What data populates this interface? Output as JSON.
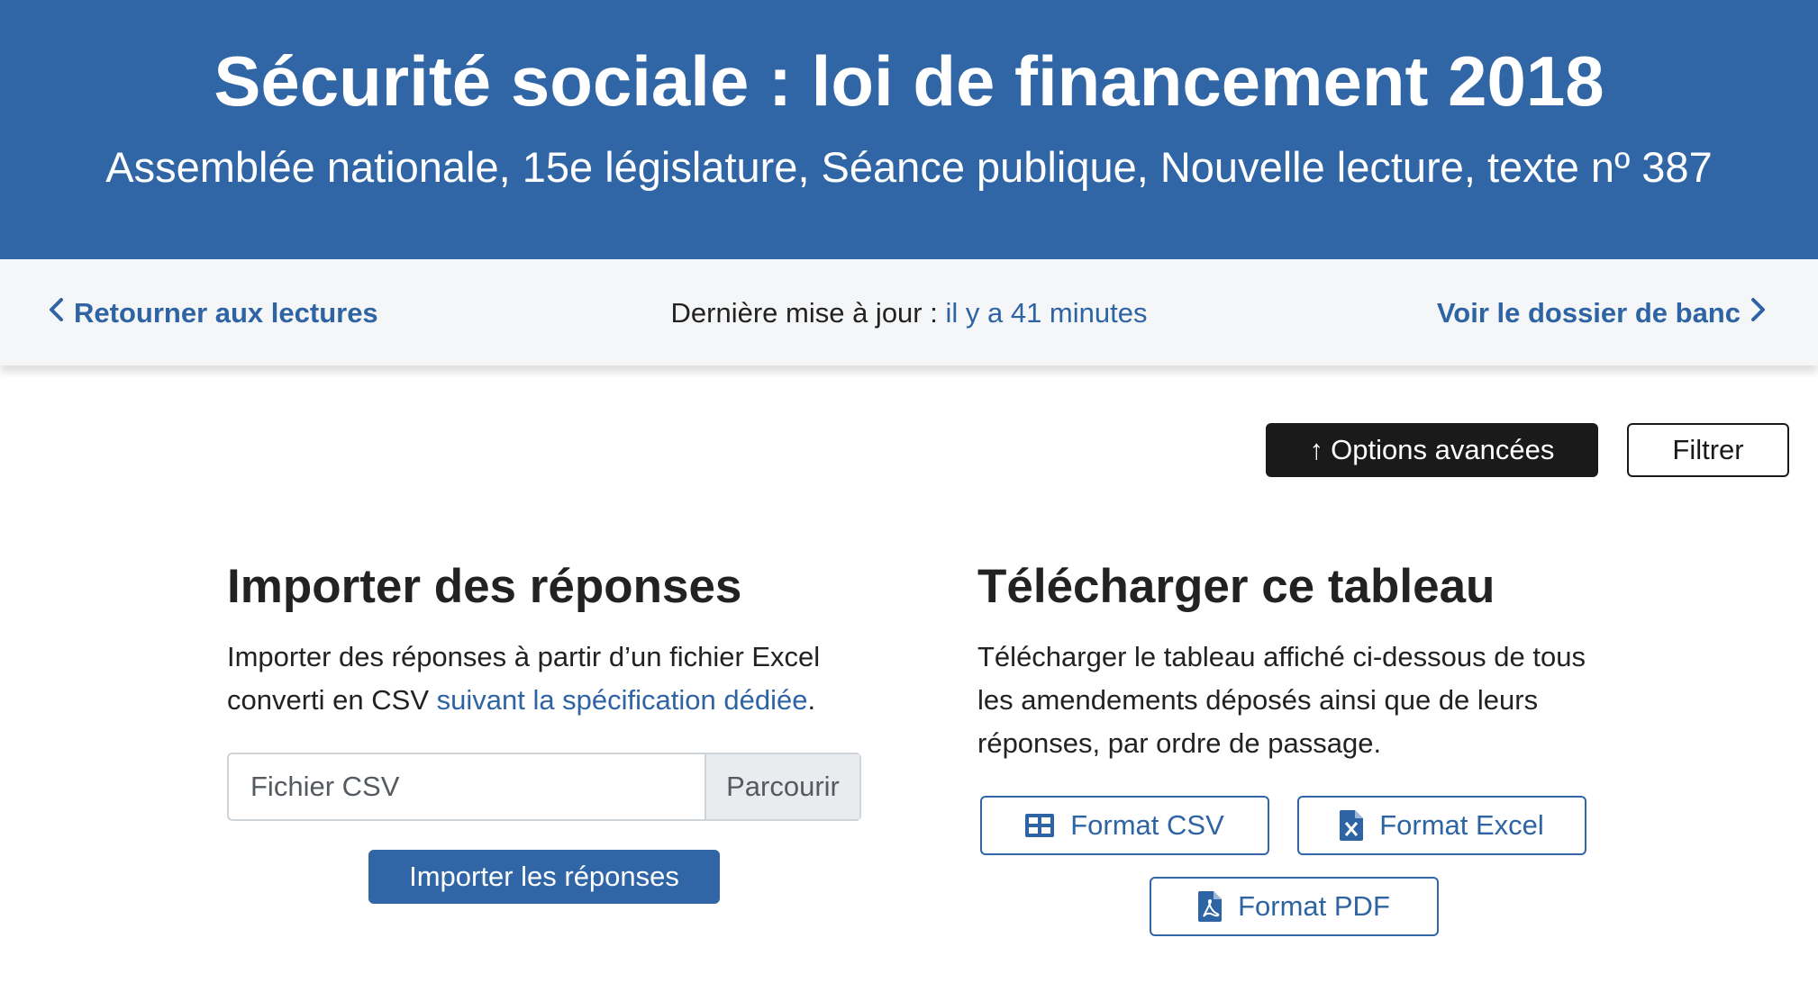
{
  "header": {
    "title": "Sécurité sociale : loi de financement 2018",
    "subtitle": "Assemblée nationale, 15e législature, Séance publique, Nouvelle lecture, texte nº 387",
    "background_color": "#3166a6"
  },
  "nav": {
    "back_label": "Retourner aux lectures",
    "update_prefix": "Dernière mise à jour :",
    "update_ago": "il y a 41 minutes",
    "forward_label": "Voir le dossier de banc",
    "link_color": "#2e64a3"
  },
  "toolbar": {
    "options_arrow": "↑",
    "options_label": "Options avancées",
    "filter_label": "Filtrer"
  },
  "import_section": {
    "title": "Importer des réponses",
    "text_before_link": "Importer des réponses à partir d’un fichier Excel converti en CSV ",
    "link_text": "suivant la spécification dédiée",
    "text_after_link": ".",
    "file_placeholder": "Fichier CSV",
    "browse_label": "Parcourir",
    "submit_label": "Importer les réponses"
  },
  "download_section": {
    "title": "Télécharger ce tableau",
    "text": "Télécharger le tableau affiché ci-dessous de tous les amendements déposés ainsi que de leurs réponses, par ordre de passage.",
    "csv_label": "Format CSV",
    "excel_label": "Format Excel",
    "pdf_label": "Format PDF",
    "csv_icon": "table-icon",
    "excel_icon": "excel-file-icon",
    "pdf_icon": "pdf-file-icon"
  }
}
